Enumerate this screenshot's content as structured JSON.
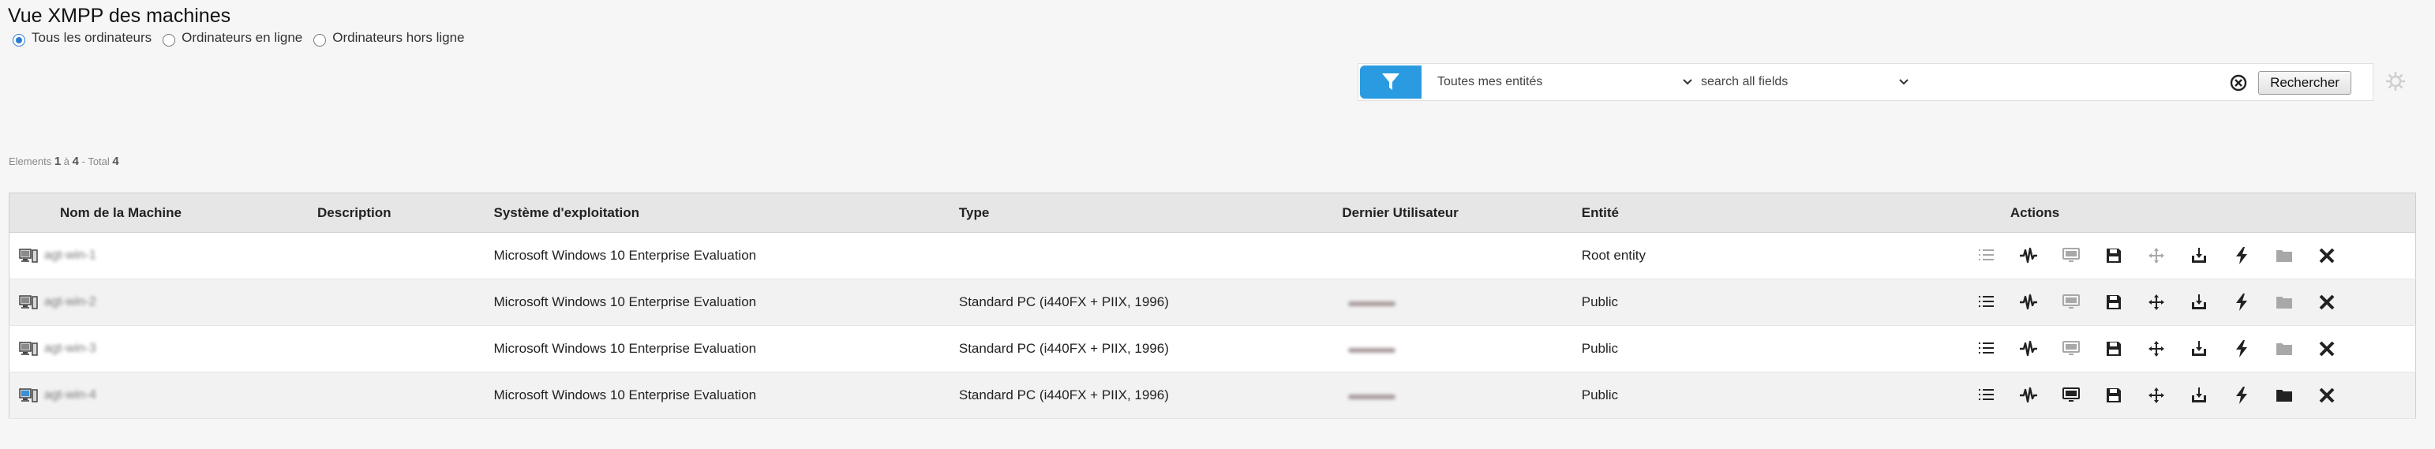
{
  "page": {
    "title": "Vue XMPP des machines"
  },
  "filters": {
    "radios": [
      {
        "label": "Tous les ordinateurs",
        "checked": true
      },
      {
        "label": "Ordinateurs en ligne",
        "checked": false
      },
      {
        "label": "Ordinateurs hors ligne",
        "checked": false
      }
    ]
  },
  "search": {
    "entity_select": "Toutes mes entités",
    "field_select": "search all fields",
    "query": "",
    "button_label": "Rechercher"
  },
  "pagination": {
    "prefix": "Elements",
    "from": "1",
    "sep": "à",
    "to": "4",
    "total_label": "- Total",
    "total": "4"
  },
  "table": {
    "columns": [
      "Nom de la Machine",
      "Description",
      "Système d'exploitation",
      "Type",
      "Dernier Utilisateur",
      "Entité",
      "Actions"
    ],
    "rows": [
      {
        "name": "agt-win-1",
        "description": "",
        "os": "Microsoft Windows 10 Enterprise Evaluation",
        "type": "",
        "user": "",
        "entity": "Root entity",
        "online": false
      },
      {
        "name": "agt-win-2",
        "description": "",
        "os": "Microsoft Windows 10 Enterprise Evaluation",
        "type": "Standard PC (i440FX + PIIX, 1996)",
        "user": "user",
        "entity": "Public",
        "online": false
      },
      {
        "name": "agt-win-3",
        "description": "",
        "os": "Microsoft Windows 10 Enterprise Evaluation",
        "type": "Standard PC (i440FX + PIIX, 1996)",
        "user": "user",
        "entity": "Public",
        "online": false
      },
      {
        "name": "agt-win-4",
        "description": "",
        "os": "Microsoft Windows 10 Enterprise Evaluation",
        "type": "Standard PC (i440FX + PIIX, 1996)",
        "user": "user",
        "entity": "Public",
        "online": true
      }
    ],
    "action_icons": [
      "list-icon",
      "pulse-icon",
      "monitor-icon",
      "floppy-icon",
      "move-icon",
      "download-icon",
      "lightning-icon",
      "folder-icon",
      "delete-icon"
    ]
  },
  "colors": {
    "accent": "#2a9be0",
    "header_bg": "#e6e6e6",
    "icon_dark": "#222222",
    "icon_faded": "#a8a8a8"
  }
}
